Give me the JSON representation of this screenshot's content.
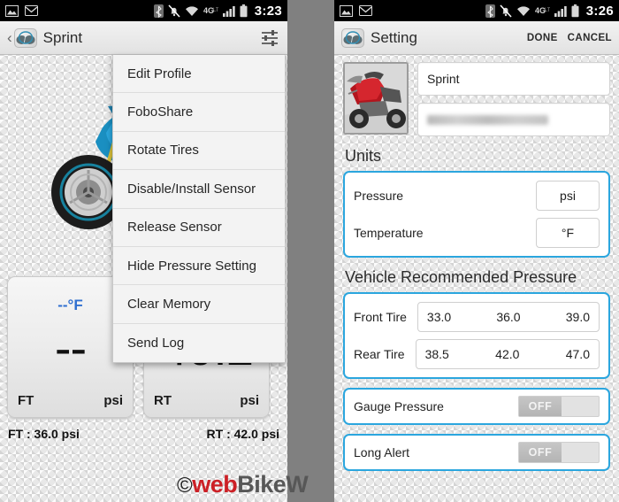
{
  "left": {
    "statusbar": {
      "time": "3:23",
      "icons": [
        "image-icon",
        "envelope-icon",
        "bluetooth-icon",
        "bell-muted-icon",
        "wifi-icon",
        "4glte-icon",
        "signal-bars-icon",
        "battery-icon"
      ]
    },
    "appbar": {
      "back_label": "‹",
      "title": "Sprint",
      "settings_icon": "sliders-icon",
      "logo_icon": "fobo-logo-icon"
    },
    "menu": {
      "items": [
        {
          "label": "Edit Profile"
        },
        {
          "label": "FoboShare"
        },
        {
          "label": "Rotate Tires"
        },
        {
          "label": "Disable/Install Sensor"
        },
        {
          "label": "Release Sensor"
        },
        {
          "label": "Hide Pressure Setting"
        },
        {
          "label": "Clear Memory"
        },
        {
          "label": "Send Log"
        }
      ]
    },
    "tiles": [
      {
        "temp": "--°F",
        "value": "--",
        "position": "FT",
        "unit": "psi"
      },
      {
        "temp": "",
        "value": "40.2",
        "position": "RT",
        "unit": "psi"
      }
    ],
    "footer": {
      "front": "FT : 36.0 psi",
      "rear": "RT : 42.0 psi"
    },
    "vehicle_image": "blue-sportbike-illustration"
  },
  "right": {
    "statusbar": {
      "time": "3:26",
      "icons": [
        "image-icon",
        "envelope-icon",
        "bluetooth-icon",
        "bell-muted-icon",
        "wifi-icon",
        "4glte-icon",
        "signal-bars-icon",
        "battery-icon"
      ]
    },
    "appbar": {
      "title": "Setting",
      "done_label": "DONE",
      "cancel_label": "CANCEL",
      "logo_icon": "fobo-logo-icon"
    },
    "profile": {
      "photo": "red-motorcycle-photo",
      "name_value": "Sprint",
      "second_field_value": ""
    },
    "units": {
      "heading": "Units",
      "rows": [
        {
          "label": "Pressure",
          "value": "psi"
        },
        {
          "label": "Temperature",
          "value": "°F"
        }
      ]
    },
    "recommended": {
      "heading": "Vehicle Recommended Pressure",
      "rows": [
        {
          "label": "Front Tire",
          "low": "33.0",
          "mid": "36.0",
          "high": "39.0"
        },
        {
          "label": "Rear Tire",
          "low": "38.5",
          "mid": "42.0",
          "high": "47.0"
        }
      ]
    },
    "toggles": [
      {
        "label": "Gauge Pressure",
        "state": "OFF"
      },
      {
        "label": "Long Alert",
        "state": "OFF"
      }
    ]
  },
  "watermark": {
    "copyright": "©",
    "part1": "web",
    "part2": "BikeW"
  },
  "colors": {
    "accent_blue": "#2ba6de",
    "temp_blue": "#2f6fd0",
    "watermark_red": "#cc2026",
    "divider_gray": "#808080"
  }
}
